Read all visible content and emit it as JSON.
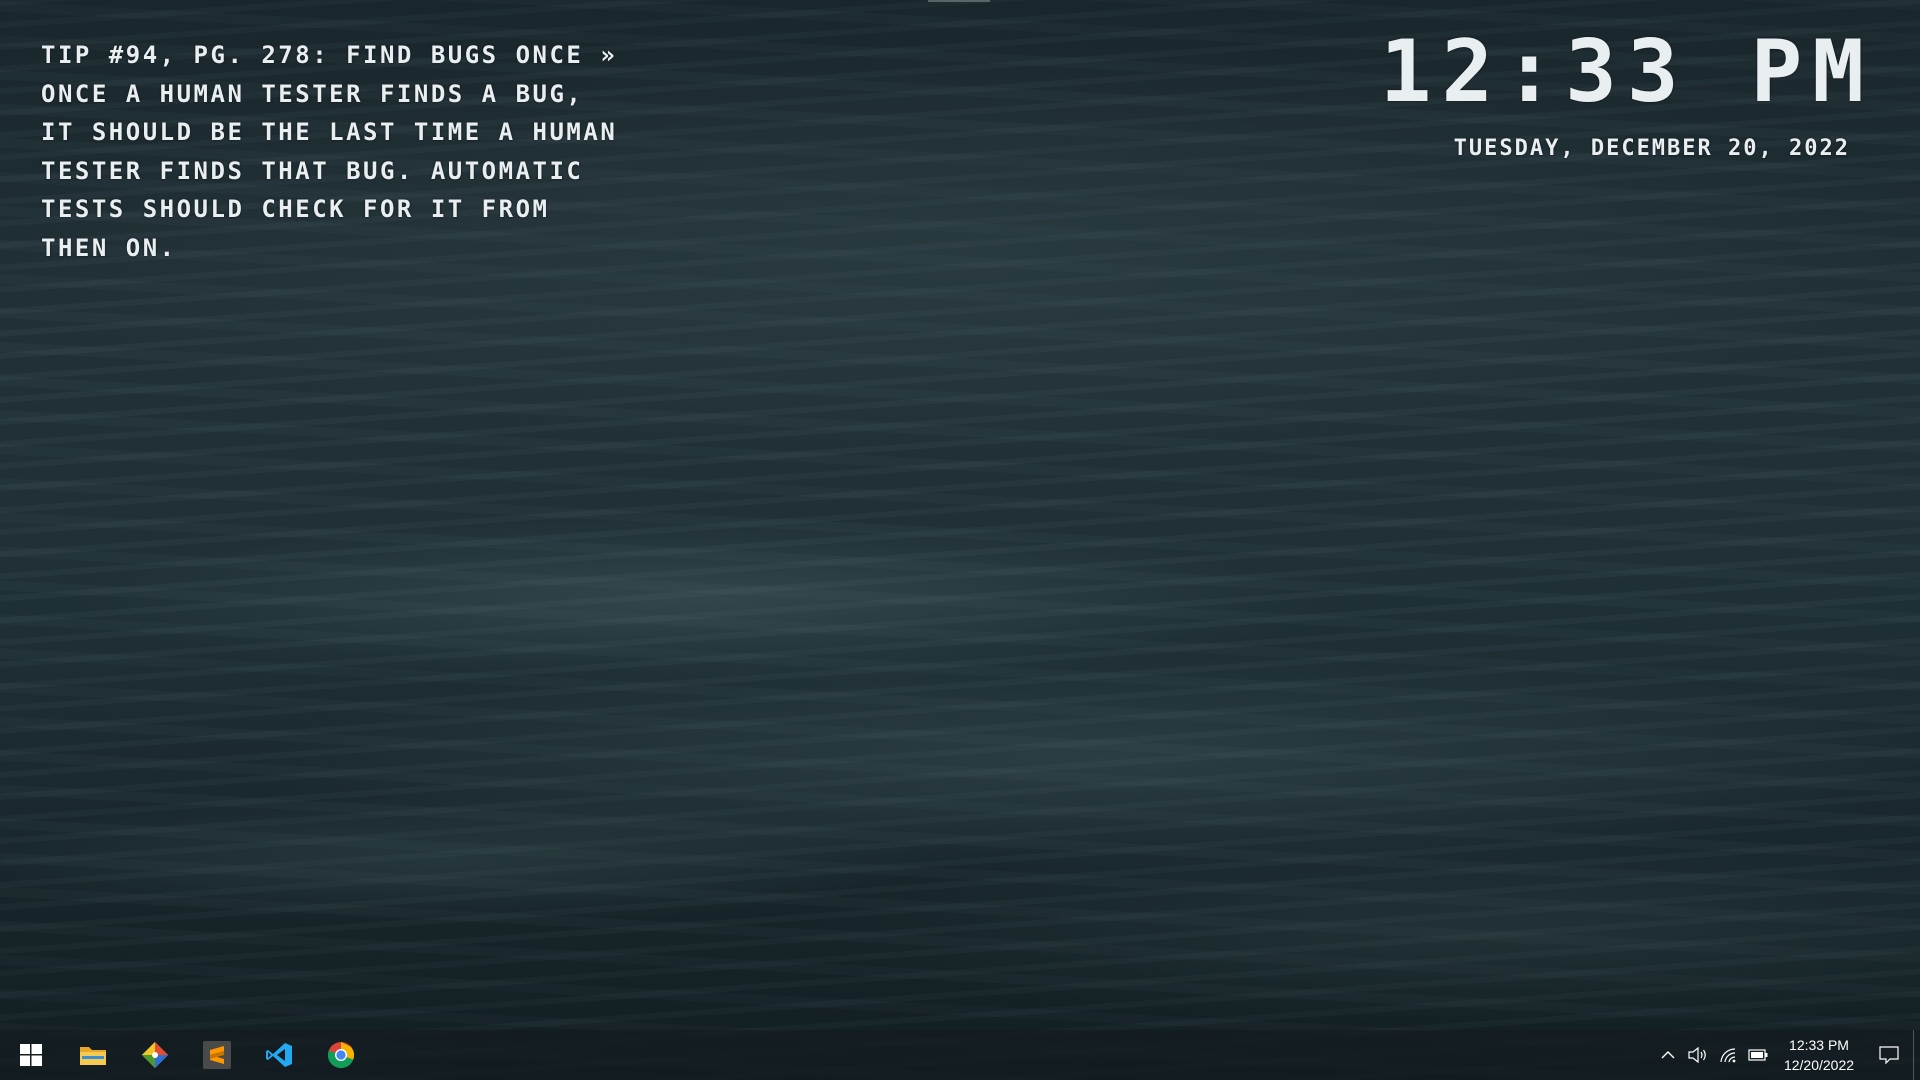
{
  "desktop": {
    "tip_lines": [
      "TIP #94, PG. 278: FIND BUGS ONCE »",
      "ONCE A HUMAN TESTER FINDS A BUG,",
      "IT SHOULD BE THE LAST TIME A HUMAN",
      "TESTER FINDS THAT BUG. AUTOMATIC",
      "TESTS SHOULD CHECK FOR IT FROM",
      "THEN ON."
    ],
    "clock": "12:33 PM",
    "date": "TUESDAY, DECEMBER 20, 2022"
  },
  "taskbar": {
    "pinned": [
      {
        "name": "start-button",
        "icon": "windows-logo-icon"
      },
      {
        "name": "file-explorer",
        "icon": "folder-icon",
        "color": "#f2c14e"
      },
      {
        "name": "git-gui",
        "icon": "git-diamond-icon"
      },
      {
        "name": "sublime-text",
        "icon": "sublime-icon",
        "color": "#ff9800"
      },
      {
        "name": "visual-studio-code",
        "icon": "vscode-icon",
        "color": "#23a9f2"
      },
      {
        "name": "google-chrome",
        "icon": "chrome-icon"
      }
    ],
    "tray": {
      "icons": [
        "chevron-up-icon",
        "volume-icon",
        "network-icon",
        "battery-icon"
      ],
      "time": "12:33 PM",
      "date": "12/20/2022"
    }
  },
  "colors": {
    "taskbar_bg": "#141c20",
    "text": "#e9eef0"
  }
}
